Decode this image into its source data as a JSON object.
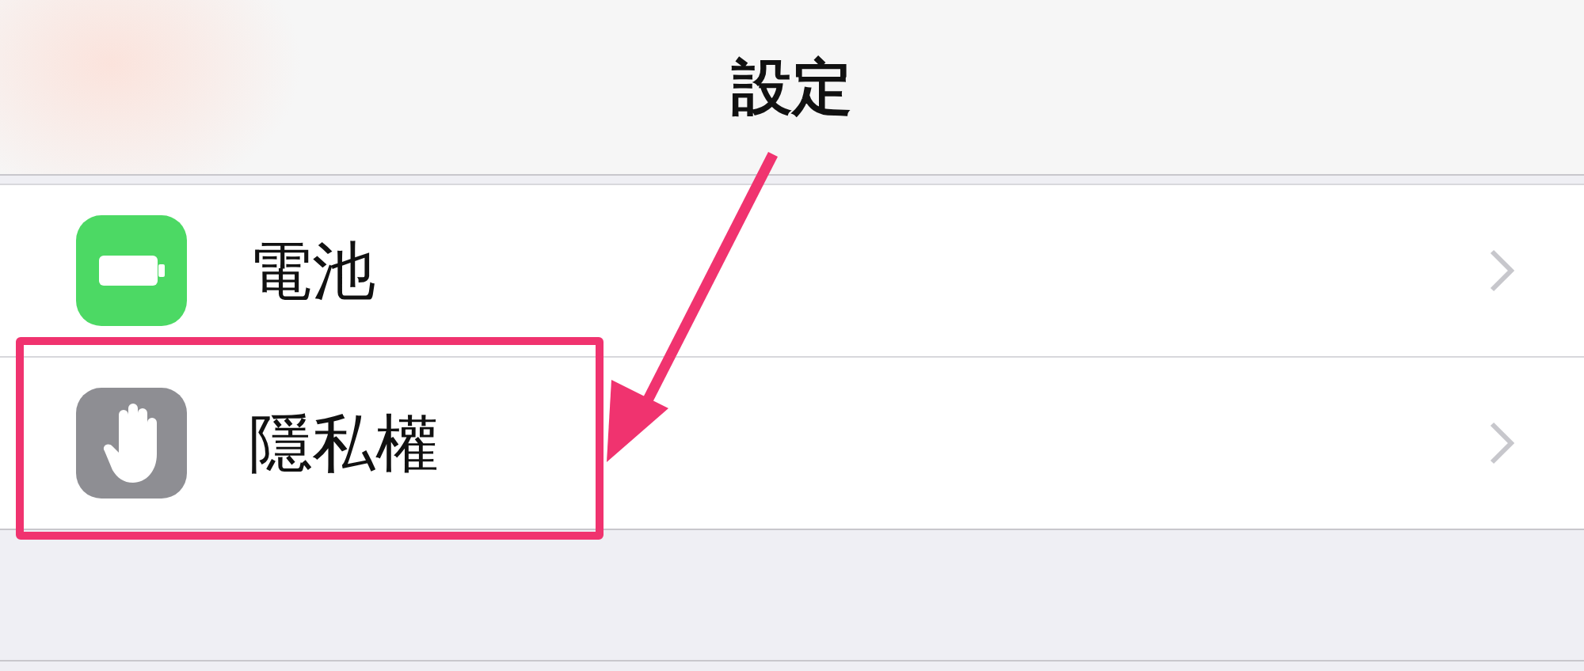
{
  "title": "設定",
  "rows": [
    {
      "label": "電池",
      "kind": "battery",
      "color": "#4cd964",
      "highlighted": false
    },
    {
      "label": "隱私權",
      "kind": "hand",
      "color": "#8e8e93",
      "highlighted": true
    }
  ]
}
